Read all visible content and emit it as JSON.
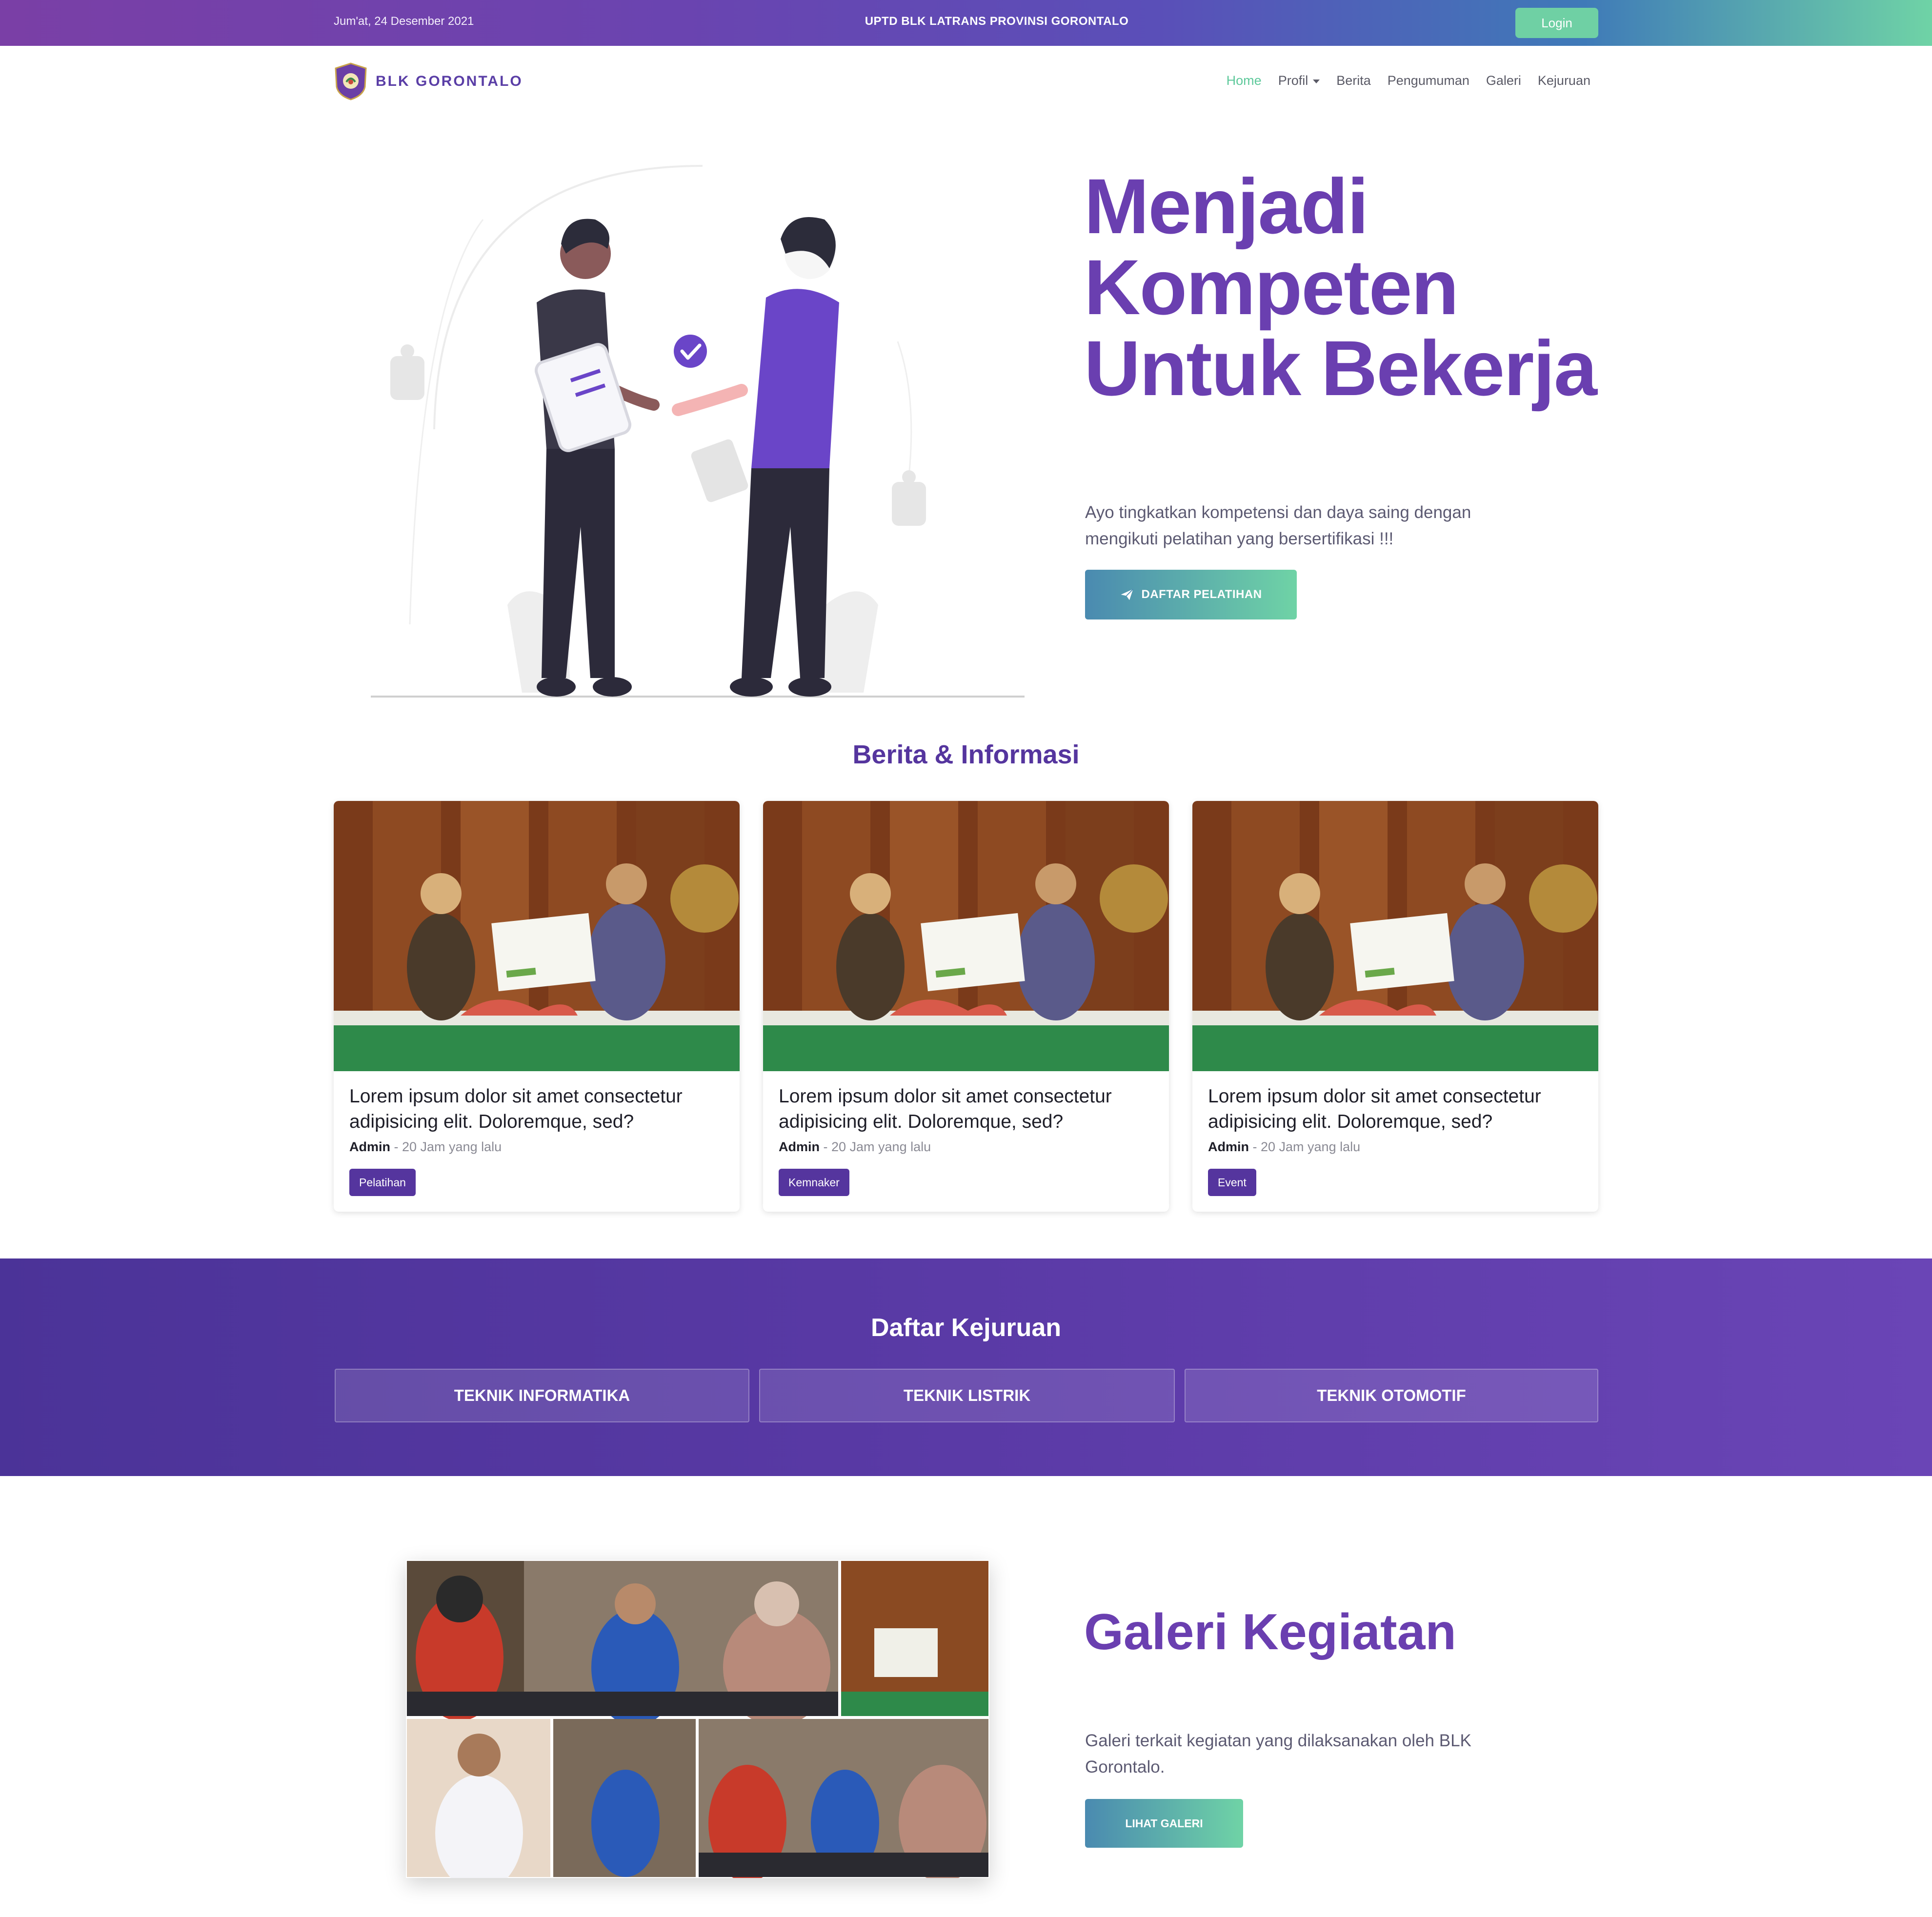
{
  "topbar": {
    "date": "Jum'at, 24 Desember 2021",
    "org": "UPTD BLK LATRANS PROVINSI GORONTALO",
    "login": "Login"
  },
  "nav": {
    "brand": "BLK GORONTALO",
    "items": [
      "Home",
      "Profil",
      "Berita",
      "Pengumuman",
      "Galeri",
      "Kejuruan"
    ],
    "active": "Home"
  },
  "hero": {
    "title": "Menjadi Kompeten Untuk Bekerja",
    "subtitle": "Ayo tingkatkan kompetensi dan daya saing dengan mengikuti pelatihan yang bersertifikasi !!!",
    "button": "DAFTAR PELATIHAN"
  },
  "news": {
    "heading": "Berita & Informasi",
    "cards": [
      {
        "title": "Lorem ipsum dolor sit amet consectetur adipisicing elit. Doloremque, sed?",
        "author": "Admin",
        "time": " - 20 Jam yang lalu",
        "tag": "Pelatihan"
      },
      {
        "title": "Lorem ipsum dolor sit amet consectetur adipisicing elit. Doloremque, sed?",
        "author": "Admin",
        "time": " - 20 Jam yang lalu",
        "tag": "Kemnaker"
      },
      {
        "title": "Lorem ipsum dolor sit amet consectetur adipisicing elit. Doloremque, sed?",
        "author": "Admin",
        "time": " - 20 Jam yang lalu",
        "tag": "Event"
      }
    ]
  },
  "kejuruan": {
    "heading": "Daftar Kejuruan",
    "items": [
      "TEKNIK INFORMATIKA",
      "TEKNIK LISTRIK",
      "TEKNIK OTOMOTIF"
    ]
  },
  "gallery": {
    "title": "Galeri Kegiatan",
    "subtitle": "Galeri terkait kegiatan yang dilaksanakan oleh BLK Gorontalo.",
    "button": "LIHAT GALERI"
  },
  "colors": {
    "primary": "#6a3fb0",
    "accent": "#6fd3a6",
    "dark": "#55359e"
  },
  "icons": [
    "paper-plane-icon",
    "caret-down-icon",
    "brand-logo-icon",
    "check-circle-icon"
  ]
}
